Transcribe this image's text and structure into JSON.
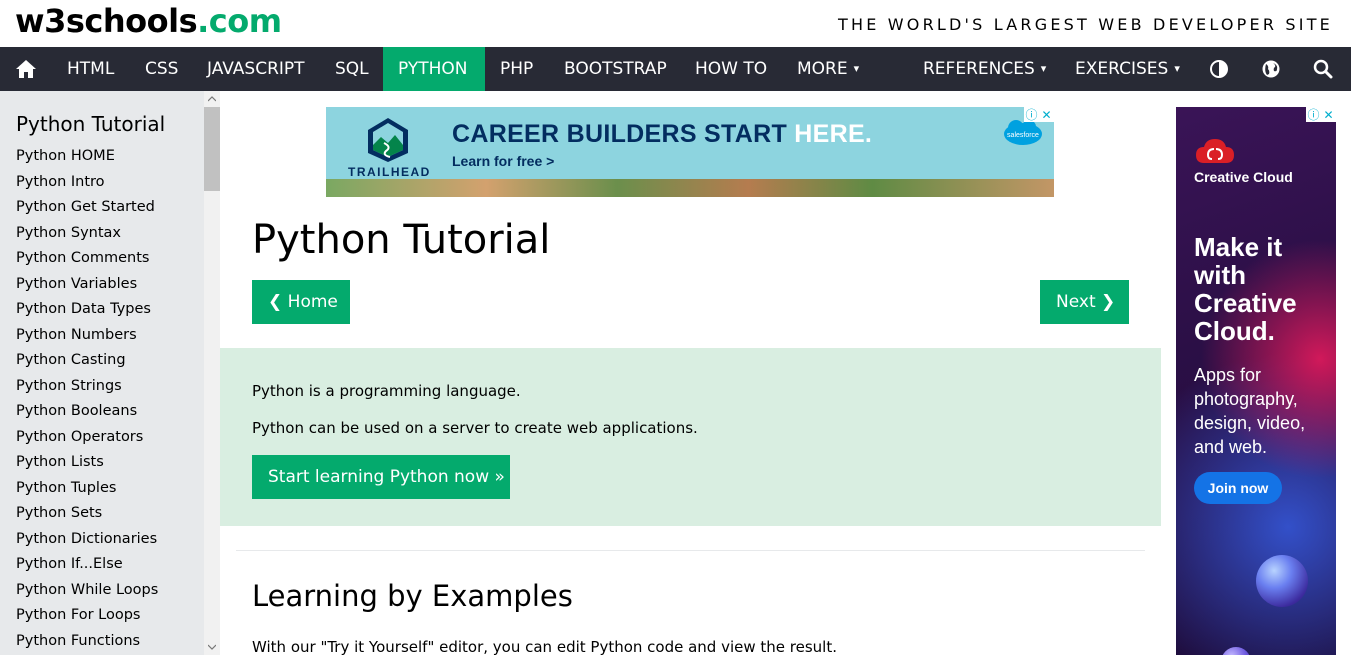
{
  "header": {
    "logo_main": "w3schools",
    "logo_suffix": ".com",
    "tagline": "THE WORLD'S LARGEST WEB DEVELOPER SITE"
  },
  "navbar": {
    "home_icon": "home-icon",
    "items": [
      "HTML",
      "CSS",
      "JAVASCRIPT",
      "SQL",
      "PYTHON",
      "PHP",
      "BOOTSTRAP",
      "HOW TO",
      "MORE",
      "REFERENCES",
      "EXERCISES"
    ],
    "active": "PYTHON",
    "caret": "▾",
    "icons": [
      "contrast-icon",
      "globe-icon",
      "search-icon"
    ],
    "bg_color": "#282A35",
    "accent_color": "#04AA6D"
  },
  "sidebar": {
    "title": "Python Tutorial",
    "links": [
      "Python HOME",
      "Python Intro",
      "Python Get Started",
      "Python Syntax",
      "Python Comments",
      "Python Variables",
      "Python Data Types",
      "Python Numbers",
      "Python Casting",
      "Python Strings",
      "Python Booleans",
      "Python Operators",
      "Python Lists",
      "Python Tuples",
      "Python Sets",
      "Python Dictionaries",
      "Python If...Else",
      "Python While Loops",
      "Python For Loops",
      "Python Functions"
    ]
  },
  "ad_top": {
    "brand": "TRAILHEAD",
    "headline_main": "CAREER BUILDERS START ",
    "headline_accent": "HERE.",
    "sub": "Learn for free >",
    "partner": "salesforce",
    "info_icon": "ⓘ",
    "close_icon": "✕"
  },
  "main": {
    "title": "Python Tutorial",
    "home_button": "Home",
    "next_button": "Next",
    "prev_chevron": "❮",
    "next_chevron": "❯",
    "intro_p1": "Python is a programming language.",
    "intro_p2": "Python can be used on a server to create web applications.",
    "start_button": "Start learning Python now »",
    "section_title": "Learning by Examples",
    "section_text": "With our \"Try it Yourself\" editor, you can edit Python code and view the result."
  },
  "ad_side": {
    "product": "Creative Cloud",
    "headline": "Make it with Creative Cloud.",
    "subline": "Apps for photography, design, video, and web.",
    "cta": "Join now"
  }
}
